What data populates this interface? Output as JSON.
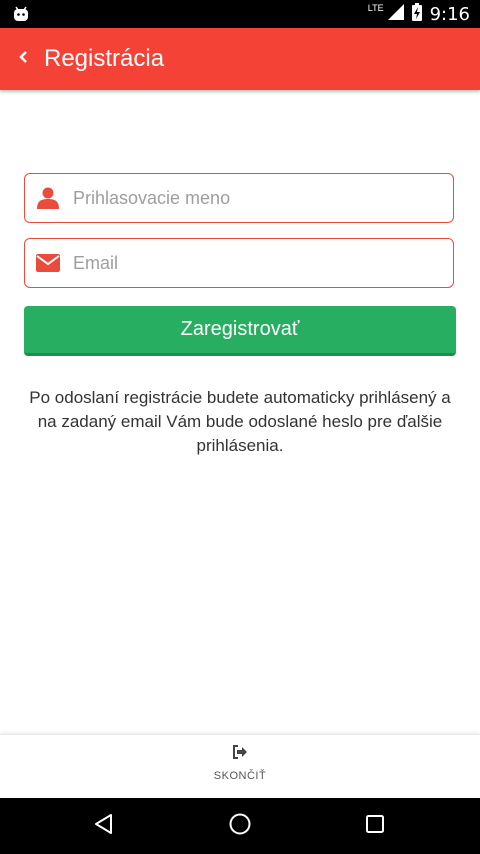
{
  "status_bar": {
    "network": "LTE",
    "time": "9:16"
  },
  "app_bar": {
    "title": "Registrácia",
    "back_icon": "chevron-left-icon"
  },
  "form": {
    "username_placeholder": "Prihlasovacie meno",
    "username_value": "",
    "email_placeholder": "Email",
    "email_value": "",
    "submit_label": "Zaregistrovať"
  },
  "info_text": "Po odoslaní registrácie budete automaticky prihlásený a na zadaný email Vám bude odoslané heslo pre ďalšie prihlásenia.",
  "bottom_bar": {
    "exit_label": "SKONČIŤ",
    "exit_icon": "sign-out-icon"
  },
  "colors": {
    "accent_red": "#f44336",
    "field_border": "#e74c3c",
    "button_green": "#27ae60"
  }
}
